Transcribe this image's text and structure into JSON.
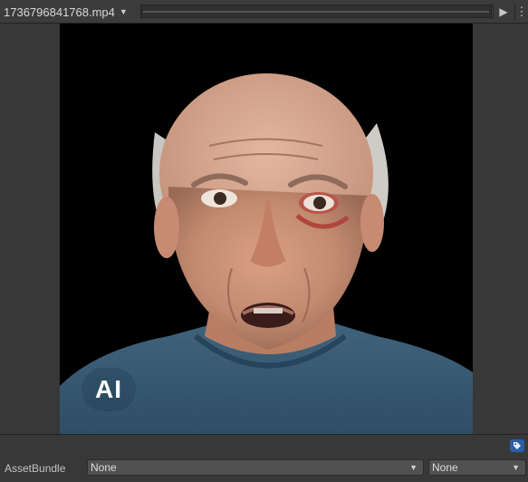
{
  "toolbar": {
    "filename": "1736796841768.mp4",
    "play_icon": "play-icon",
    "more_icon": "kebab-menu-icon"
  },
  "preview": {
    "overlay_text": "AI",
    "background_color": "#000000"
  },
  "asset_bundle": {
    "label": "AssetBundle",
    "name_value": "None",
    "variant_value": "None"
  },
  "colors": {
    "panel": "#383838",
    "toolbar": "#3c3c3c",
    "dropdown": "#515151",
    "tag_accent": "#2a5ea8"
  }
}
